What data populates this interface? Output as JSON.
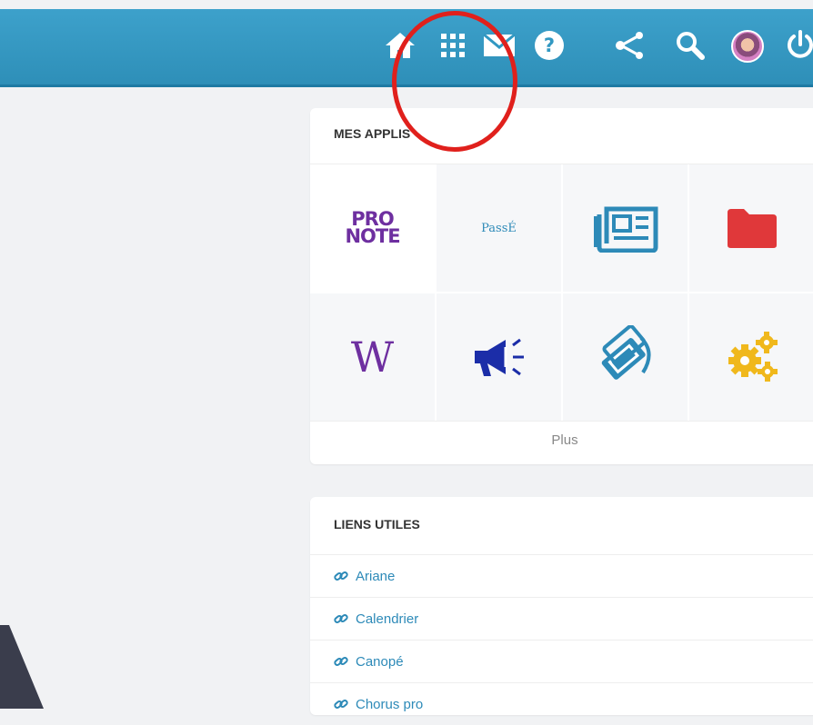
{
  "apps_panel": {
    "title": "MES APPLIS",
    "plus_label": "Plus",
    "tiles": [
      {
        "icon": "pronote-icon",
        "text_lines": [
          "PRO",
          "NOTE"
        ]
      },
      {
        "icon": "passe-icon",
        "text": "PassÉ"
      },
      {
        "icon": "newspaper-icon"
      },
      {
        "icon": "folder-icon"
      },
      {
        "icon": "wikipedia-icon",
        "text": "W"
      },
      {
        "icon": "megaphone-icon"
      },
      {
        "icon": "tickets-icon"
      },
      {
        "icon": "gears-icon"
      }
    ]
  },
  "links_panel": {
    "title": "LIENS UTILES",
    "links": [
      {
        "label": "Ariane"
      },
      {
        "label": "Calendrier"
      },
      {
        "label": "Canopé"
      },
      {
        "label": "Chorus pro"
      }
    ]
  },
  "topbar": {
    "icons": [
      "home-icon",
      "apps-grid-icon",
      "mail-icon",
      "help-icon",
      "share-icon",
      "search-icon",
      "avatar",
      "power-icon"
    ]
  },
  "colors": {
    "topbar": "#3da1cb",
    "annotation_circle": "#e0201c",
    "link": "#2d8ab8",
    "pronote": "#6e2fa0",
    "folder": "#e0383a",
    "gears": "#f0b81c",
    "megaphone": "#1b2da8"
  }
}
